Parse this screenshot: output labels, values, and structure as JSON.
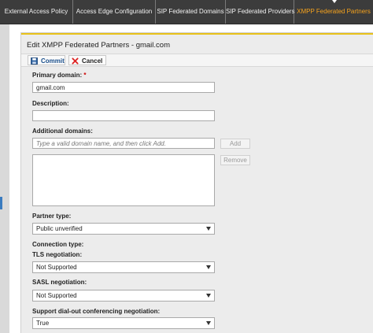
{
  "tabs": [
    {
      "label": "External Access Policy",
      "active": false
    },
    {
      "label": "Access Edge Configuration",
      "active": false
    },
    {
      "label": "SIP Federated Domains",
      "active": false
    },
    {
      "label": "SIP Federated Providers",
      "active": false
    },
    {
      "label": "XMPP Federated Partners",
      "active": true
    }
  ],
  "panel": {
    "title": "Edit XMPP Federated Partners - gmail.com",
    "commit_label": "Commit",
    "cancel_label": "Cancel"
  },
  "form": {
    "primary_domain_label": "Primary domain:",
    "required_mark": "*",
    "primary_domain_value": "gmail.com",
    "description_label": "Description:",
    "description_value": "",
    "additional_domains_label": "Additional domains:",
    "additional_domains_placeholder": "Type a valid domain name, and then click Add.",
    "add_label": "Add",
    "remove_label": "Remove",
    "partner_type_label": "Partner type:",
    "partner_type_value": "Public unverified",
    "connection_type_label": "Connection type:",
    "tls_label": "TLS negotiation:",
    "tls_value": "Not Supported",
    "sasl_label": "SASL negotiation:",
    "sasl_value": "Not Supported",
    "dialout_label": "Support dial-out conferencing negotiation:",
    "dialout_value": "True"
  },
  "colors": {
    "tabbar_bg": "#3c3c3c",
    "active_tab": "#f7a31c",
    "accent_line": "#e9c21a",
    "required": "#cc0000"
  }
}
